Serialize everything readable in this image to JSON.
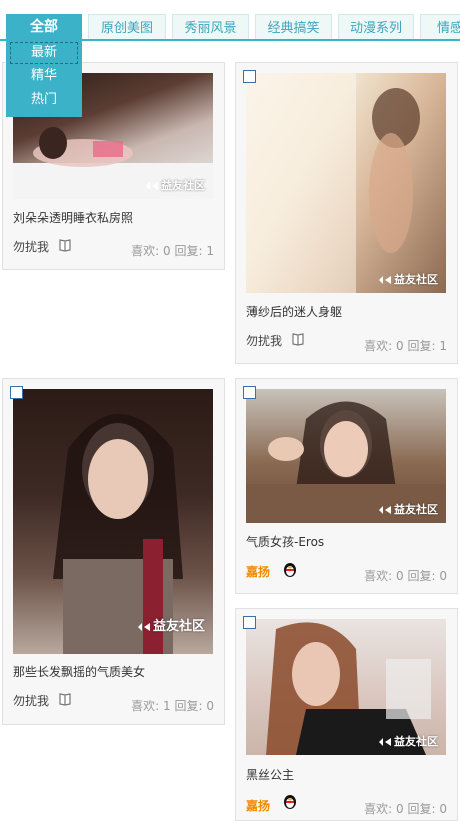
{
  "tabs": {
    "all": "全部",
    "dropdown": [
      "最新",
      "精华",
      "热门"
    ],
    "items": [
      "原创美图",
      "秀丽风景",
      "经典搞笑",
      "动漫系列",
      "情感"
    ]
  },
  "watermark": "益友社区",
  "stats_like_prefix": "喜欢:",
  "stats_reply_prefix": "回复:",
  "posts": [
    {
      "title": "刘朵朵透明睡衣私房照",
      "author": "勿扰我",
      "likes": "0",
      "replies": "1"
    },
    {
      "title": "薄纱后的迷人身躯",
      "author": "勿扰我",
      "likes": "0",
      "replies": "1"
    },
    {
      "title": "那些长发飘摇的气质美女",
      "author": "勿扰我",
      "likes": "1",
      "replies": "0"
    },
    {
      "title": "气质女孩-Eros",
      "author": "嘉扬",
      "likes": "0",
      "replies": "0"
    },
    {
      "title": "黑丝公主",
      "author": "嘉扬",
      "likes": "0",
      "replies": "0"
    }
  ],
  "colors": {
    "accent": "#3cb2c8",
    "hot_author": "#f08a00",
    "stats": "#999999"
  }
}
